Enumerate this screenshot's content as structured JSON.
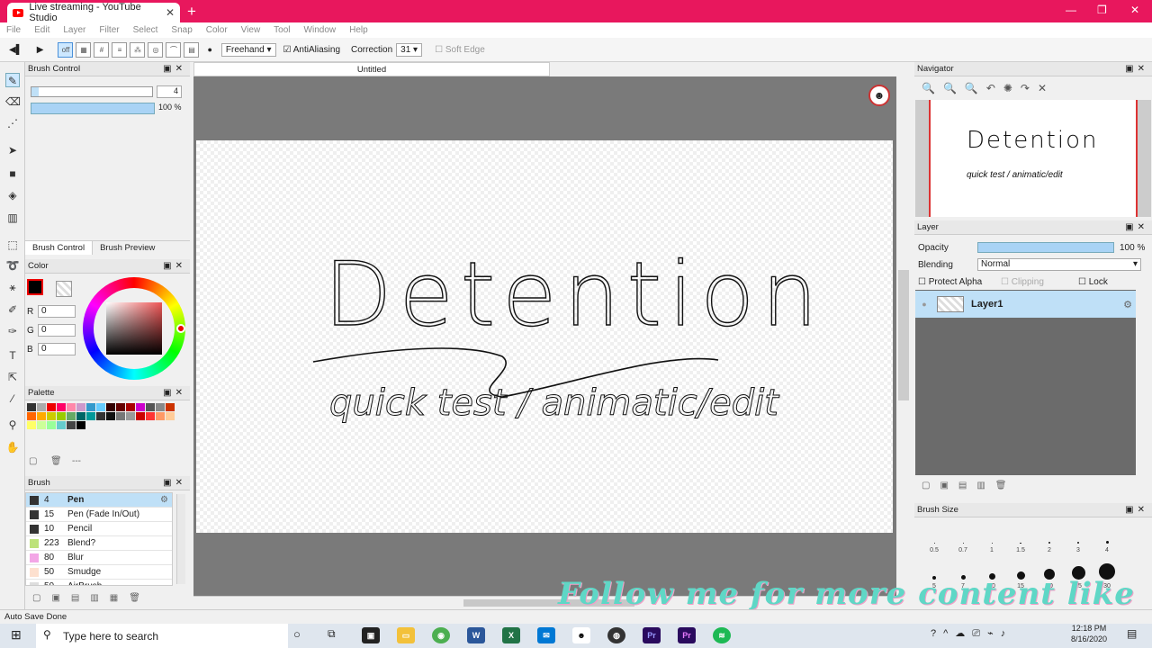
{
  "browser": {
    "tab_title": "Live streaming - YouTube Studio",
    "new_tab": "+",
    "min": "—",
    "max": "❐",
    "close": "✕"
  },
  "menu": [
    "File",
    "Edit",
    "Layer",
    "Filter",
    "Select",
    "Snap",
    "Color",
    "View",
    "Tool",
    "Window",
    "Help"
  ],
  "toolbar": {
    "stroke_mode": "Freehand",
    "antialias_label": "AntiAliasing",
    "correction_label": "Correction",
    "correction_value": "31",
    "soft_edge_label": "Soft Edge"
  },
  "brush_control": {
    "title": "Brush Control",
    "size_value": "4",
    "opacity_value": "100 %",
    "tab1": "Brush Control",
    "tab2": "Brush Preview"
  },
  "color": {
    "title": "Color",
    "r_label": "R",
    "g_label": "G",
    "b_label": "B",
    "r": "0",
    "g": "0",
    "b": "0",
    "current": "#000000"
  },
  "palette": {
    "title": "Palette",
    "more": "---",
    "colors": [
      "#333",
      "#aaa",
      "#e00",
      "#f06",
      "#f8a",
      "#c9c",
      "#39c",
      "#6cf",
      "#300",
      "#600",
      "#a00",
      "#c0c",
      "#555",
      "#888",
      "#c30",
      "#f60",
      "#fa0",
      "#cc0",
      "#9c0",
      "#6a6",
      "#066",
      "#099",
      "#333",
      "#111",
      "#777",
      "#999",
      "#c00",
      "#f33",
      "#f96",
      "#fc9",
      "#ff6",
      "#cf9",
      "#9f9",
      "#6cc",
      "#444",
      "#000"
    ]
  },
  "brush": {
    "title": "Brush",
    "items": [
      {
        "size": "4",
        "name": "Pen",
        "color": "#333",
        "selected": true
      },
      {
        "size": "15",
        "name": "Pen (Fade In/Out)",
        "color": "#333"
      },
      {
        "size": "10",
        "name": "Pencil",
        "color": "#333"
      },
      {
        "size": "223",
        "name": "Blend?",
        "color": "#bde27a"
      },
      {
        "size": "80",
        "name": "Blur",
        "color": "#f3a6e6"
      },
      {
        "size": "50",
        "name": "Smudge",
        "color": "#fde0cf"
      },
      {
        "size": "50",
        "name": "AirBrush",
        "color": "#ddd"
      }
    ]
  },
  "document": {
    "tab_title": "Untitled",
    "line1": "Detention",
    "line2": "quick test / animatic/edit"
  },
  "navigator": {
    "title": "Navigator"
  },
  "layer": {
    "title": "Layer",
    "opacity_label": "Opacity",
    "opacity_value": "100 %",
    "blending_label": "Blending",
    "blending_value": "Normal",
    "protect_alpha": "Protect Alpha",
    "clipping": "Clipping",
    "lock": "Lock",
    "layer_name": "Layer1"
  },
  "brush_size": {
    "title": "Brush Size",
    "sizes": [
      {
        "label": "0.5",
        "d": 1
      },
      {
        "label": "0.7",
        "d": 1
      },
      {
        "label": "1",
        "d": 1
      },
      {
        "label": "1.5",
        "d": 1.5
      },
      {
        "label": "2",
        "d": 2
      },
      {
        "label": "3",
        "d": 2.5
      },
      {
        "label": "4",
        "d": 3
      },
      {
        "label": "5",
        "d": 4
      },
      {
        "label": "7",
        "d": 5
      },
      {
        "label": "10",
        "d": 7
      },
      {
        "label": "15",
        "d": 9
      },
      {
        "label": "20",
        "d": 12
      },
      {
        "label": "25",
        "d": 15
      },
      {
        "label": "30",
        "d": 18
      }
    ]
  },
  "status": {
    "text": "Auto Save Done"
  },
  "overlay": {
    "text": "Follow me for more content like this!"
  },
  "taskbar": {
    "search_placeholder": "Type here to search",
    "time": "12:18 PM",
    "date": "8/16/2020"
  }
}
